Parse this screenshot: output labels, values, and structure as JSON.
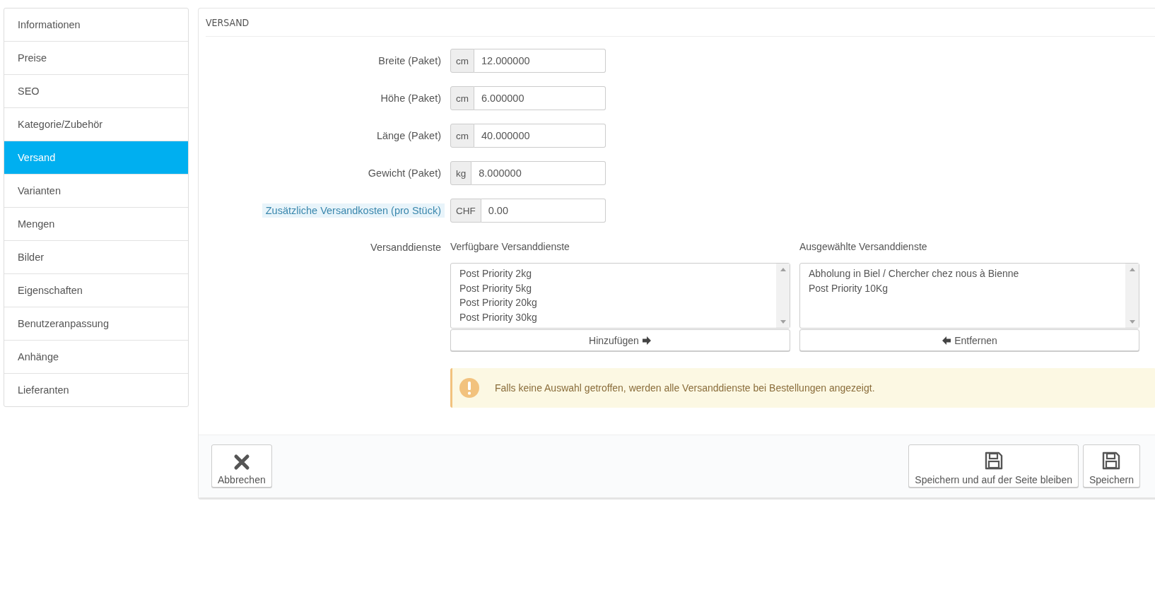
{
  "sidebar": {
    "items": [
      {
        "label": "Informationen",
        "selected": false
      },
      {
        "label": "Preise",
        "selected": false
      },
      {
        "label": "SEO",
        "selected": false
      },
      {
        "label": "Kategorie/Zubehör",
        "selected": false
      },
      {
        "label": "Versand",
        "selected": true
      },
      {
        "label": "Varianten",
        "selected": false
      },
      {
        "label": "Mengen",
        "selected": false
      },
      {
        "label": "Bilder",
        "selected": false
      },
      {
        "label": "Eigenschaften",
        "selected": false
      },
      {
        "label": "Benutzeranpassung",
        "selected": false
      },
      {
        "label": "Anhänge",
        "selected": false
      },
      {
        "label": "Lieferanten",
        "selected": false
      }
    ]
  },
  "panel": {
    "title": "VERSAND",
    "fields": [
      {
        "label": "Breite (Paket)",
        "unit": "cm",
        "value": "12.000000",
        "help": false
      },
      {
        "label": "Höhe (Paket)",
        "unit": "cm",
        "value": "6.000000",
        "help": false
      },
      {
        "label": "Länge (Paket)",
        "unit": "cm",
        "value": "40.000000",
        "help": false
      },
      {
        "label": "Gewicht (Paket)",
        "unit": "kg",
        "value": "8.000000",
        "help": false
      },
      {
        "label": "Zusätzliche Versandkosten (pro Stück)",
        "unit": "CHF",
        "value": "0.00",
        "help": true
      }
    ],
    "carriers": {
      "label": "Versanddienste",
      "available": {
        "title": "Verfügbare Versanddienste",
        "options": [
          "Post Priority 2kg",
          "Post Priority 5kg",
          "Post Priority 20kg",
          "Post Priority 30kg"
        ],
        "button": "Hinzufügen"
      },
      "selected": {
        "title": "Ausgewählte Versanddienste",
        "options": [
          "Abholung in Biel / Chercher chez nous à Bienne",
          "Post Priority 10Kg"
        ],
        "button": "Entfernen"
      }
    },
    "alert": "Falls keine Auswahl getroffen, werden alle Versanddienste bei Bestellungen angezeigt.",
    "footer": {
      "cancel": "Abbrechen",
      "save_stay": "Speichern und auf der Seite bleiben",
      "save": "Speichern"
    }
  }
}
